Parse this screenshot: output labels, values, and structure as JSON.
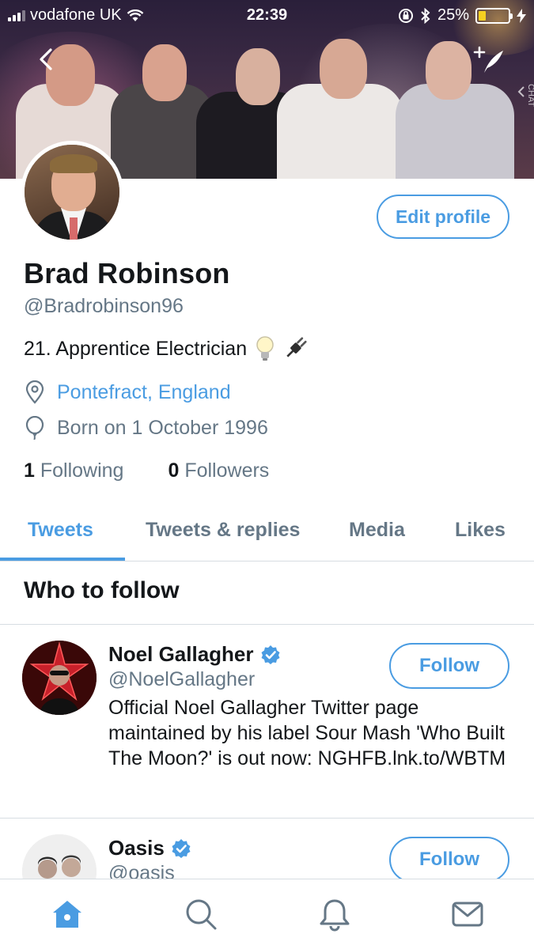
{
  "status_bar": {
    "carrier": "vodafone UK",
    "time": "22:39",
    "battery": "25%",
    "battery_level": 0.25
  },
  "header": {
    "chat_tab": "CHAT"
  },
  "profile": {
    "name": "Brad Robinson",
    "handle": "@Bradrobinson96",
    "bio": "21. Apprentice Electrician",
    "location": "Pontefract, England",
    "born": "Born on 1 October 1996",
    "following_count": "1",
    "following_label": "Following",
    "followers_count": "0",
    "followers_label": "Followers",
    "edit_profile_label": "Edit profile"
  },
  "tabs": [
    {
      "label": "Tweets",
      "active": true
    },
    {
      "label": "Tweets & replies",
      "active": false
    },
    {
      "label": "Media",
      "active": false
    },
    {
      "label": "Likes",
      "active": false
    }
  ],
  "who_to_follow": {
    "title": "Who to follow",
    "accounts": [
      {
        "name": "Noel Gallagher",
        "handle": "@NoelGallagher",
        "verified": true,
        "bio": "Official Noel Gallagher Twitter page maintained by his label Sour Mash 'Who Built The Moon?' is out now: NGHFB.lnk.to/WBTM",
        "follow_label": "Follow"
      },
      {
        "name": "Oasis",
        "handle": "@oasis",
        "verified": true,
        "follow_label": "Follow"
      }
    ]
  },
  "bottom_nav": [
    "home-icon",
    "search-icon",
    "notifications-bell-icon",
    "messages-envelope-icon"
  ],
  "colors": {
    "accent": "#4a9ce2",
    "text": "#14171a",
    "secondary": "#657786"
  }
}
